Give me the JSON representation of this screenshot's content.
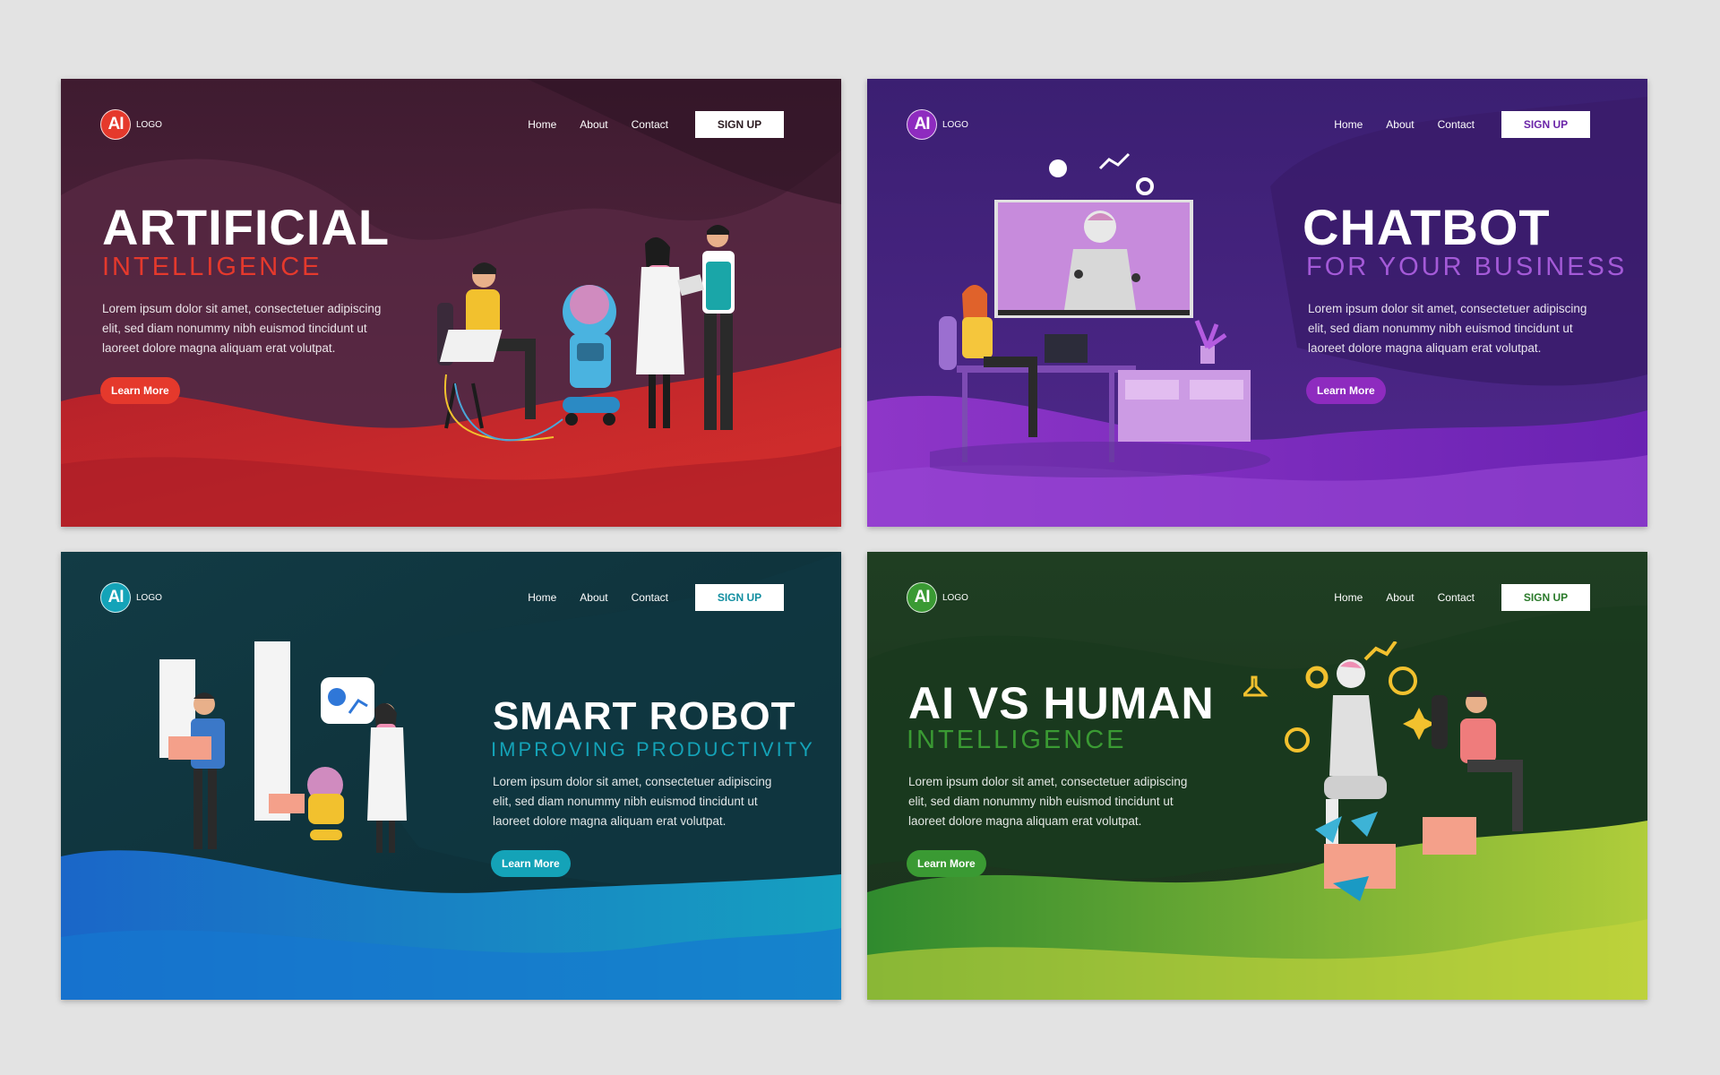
{
  "cards": [
    {
      "logo_mark": "AI",
      "logo_text": "LOGO",
      "nav": [
        "Home",
        "About",
        "Contact"
      ],
      "signup": "SIGN UP",
      "title": "ARTIFICIAL",
      "subtitle": "INTELLIGENCE",
      "body": "Lorem ipsum dolor sit amet, consectetuer adipiscing elit, sed diam nonummy nibh euismod tincidunt ut laoreet dolore magna aliquam erat volutpat.",
      "cta": "Learn More",
      "colors": {
        "accent": "#e5392c",
        "bg_top": "#4a2237",
        "bg_bottom": "#c3262a",
        "signup_text": "#2a1a20"
      }
    },
    {
      "logo_mark": "AI",
      "logo_text": "LOGO",
      "nav": [
        "Home",
        "About",
        "Contact"
      ],
      "signup": "SIGN UP",
      "title": "CHATBOT",
      "subtitle": "FOR YOUR BUSINESS",
      "body": "Lorem ipsum dolor sit amet, consectetuer adipiscing elit, sed diam nonummy nibh euismod tincidunt ut laoreet dolore magna aliquam erat volutpat.",
      "cta": "Learn More",
      "colors": {
        "accent": "#8e2bbf",
        "bg_top": "#3a1f6e",
        "bg_bottom": "#7a2bc0",
        "signup_text": "#6a24a8",
        "subtitle": "#a45ad8"
      }
    },
    {
      "logo_mark": "AI",
      "logo_text": "LOGO",
      "nav": [
        "Home",
        "About",
        "Contact"
      ],
      "signup": "SIGN UP",
      "title": "SMART ROBOT",
      "subtitle": "IMPROVING PRODUCTIVITY",
      "body": "Lorem ipsum dolor sit amet, consectetuer adipiscing elit, sed diam nonummy nibh euismod tincidunt ut laoreet dolore magna aliquam erat volutpat.",
      "cta": "Learn More",
      "colors": {
        "accent": "#14a3b8",
        "bg_top": "#0f3a44",
        "bg_bottom": "#1f6fc4",
        "signup_text": "#118ea0"
      }
    },
    {
      "logo_mark": "AI",
      "logo_text": "LOGO",
      "nav": [
        "Home",
        "About",
        "Contact"
      ],
      "signup": "SIGN UP",
      "title": "AI VS HUMAN",
      "subtitle": "INTELLIGENCE",
      "body": "Lorem ipsum dolor sit amet, consectetuer adipiscing elit, sed diam nonummy nibh euismod tincidunt ut laoreet dolore magna aliquam erat volutpat.",
      "cta": "Learn More",
      "colors": {
        "accent": "#3a9a33",
        "bg_top": "#1d3a1f",
        "bg_bottom": "#a8c83a",
        "signup_text": "#2a7a2a"
      }
    }
  ]
}
